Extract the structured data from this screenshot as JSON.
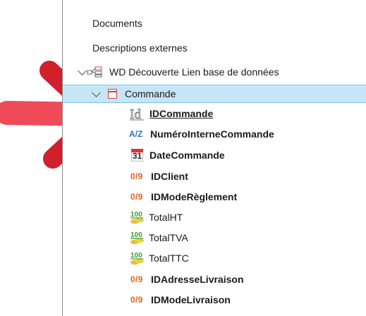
{
  "tree": {
    "items": [
      {
        "label": "Documents",
        "icon": "none"
      },
      {
        "label": "Descriptions externes",
        "icon": "none"
      },
      {
        "label": "WD Découverte Lien base de données",
        "icon": "analysis-icon"
      },
      {
        "label": "Commande",
        "icon": "table-icon"
      },
      {
        "label": "IDCommande",
        "icon": "id-icon"
      },
      {
        "label": "NuméroInterneCommande",
        "icon": "az-icon"
      },
      {
        "label": "DateCommande",
        "icon": "calendar-icon",
        "icon_text": "31"
      },
      {
        "label": "IDClient",
        "icon": "numeric-icon",
        "icon_text": "0/9"
      },
      {
        "label": "IDModeRèglement",
        "icon": "numeric-icon",
        "icon_text": "0/9"
      },
      {
        "label": "TotalHT",
        "icon": "currency-icon",
        "icon_text": "100"
      },
      {
        "label": "TotalTVA",
        "icon": "currency-icon",
        "icon_text": "100"
      },
      {
        "label": "TotalTTC",
        "icon": "currency-icon",
        "icon_text": "100"
      },
      {
        "label": "IDAdresseLivraison",
        "icon": "numeric-icon",
        "icon_text": "0/9"
      },
      {
        "label": "IDModeLivraison",
        "icon": "numeric-icon",
        "icon_text": "0/9"
      }
    ],
    "az_text": "A/Z"
  },
  "colors": {
    "selection": "#c6e6f7",
    "arrow": "#d11f2b",
    "numeric_icon": "#e0621b"
  }
}
